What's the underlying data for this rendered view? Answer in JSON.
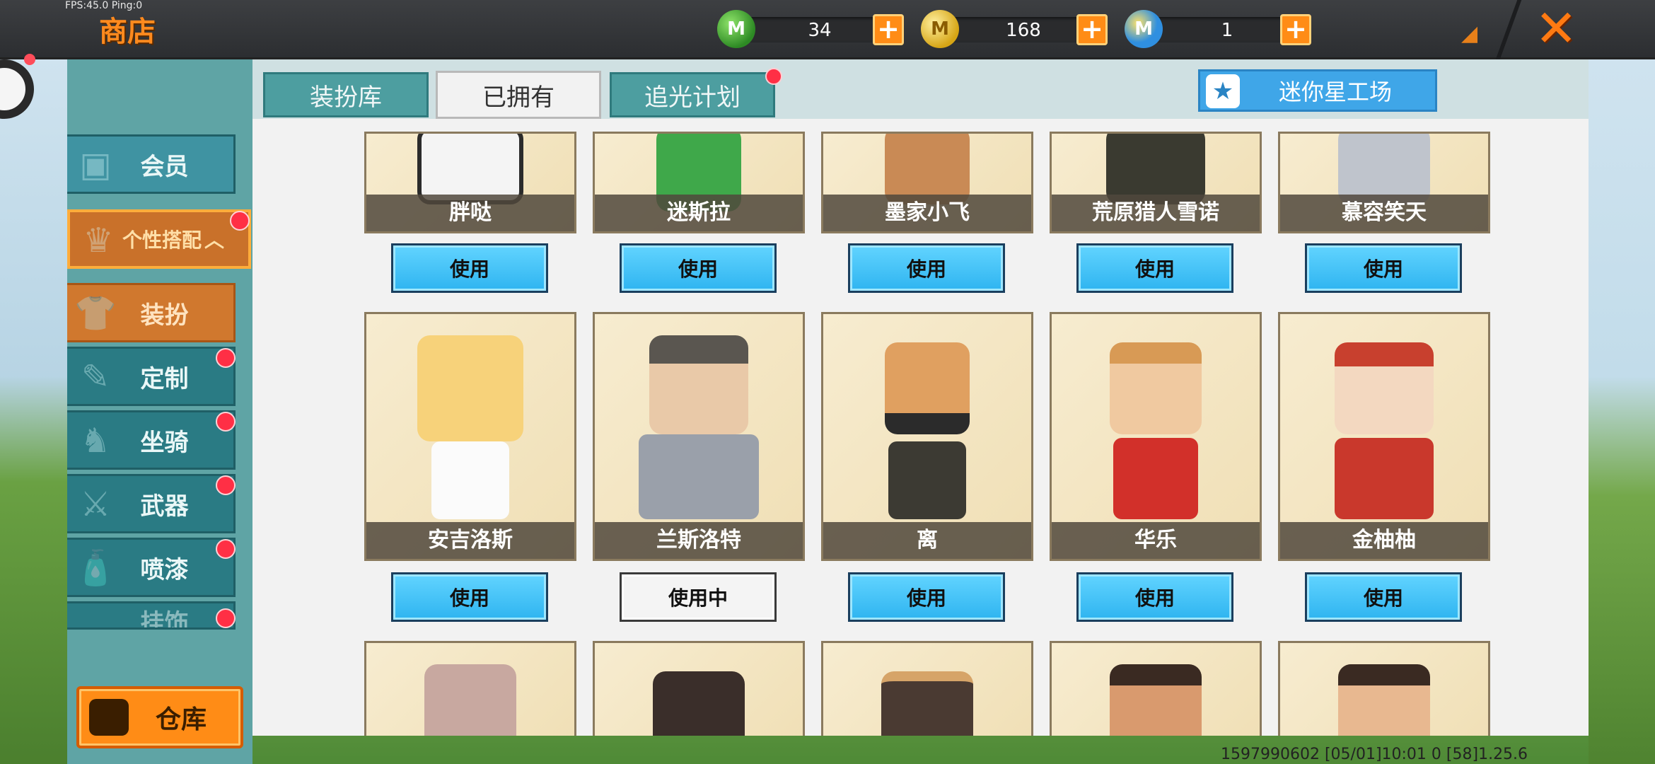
{
  "status_overlay": "FPS:45.0  Ping:0",
  "header": {
    "title": "商店",
    "currencies": [
      {
        "icon": "green-m-coin-icon",
        "value": "34"
      },
      {
        "icon": "gold-m-coin-icon",
        "value": "168"
      },
      {
        "icon": "blue-m-coin-icon",
        "value": "1"
      }
    ],
    "plus_label": "+",
    "close_label": "✕"
  },
  "sidebar": {
    "vip": "会员",
    "group": "个性搭配",
    "items": [
      {
        "label": "装扮",
        "active": true
      },
      {
        "label": "定制",
        "badge": true
      },
      {
        "label": "坐骑",
        "badge": true
      },
      {
        "label": "武器",
        "badge": true
      },
      {
        "label": "喷漆",
        "badge": true
      },
      {
        "label": "挂饰",
        "badge": true
      }
    ],
    "storage": "仓库"
  },
  "tabs": [
    {
      "label": "装扮库"
    },
    {
      "label": "已拥有",
      "active": true
    },
    {
      "label": "追光计划",
      "badge": true
    }
  ],
  "workshop": "迷你星工场",
  "cards_row1": [
    {
      "name": "胖哒",
      "button": "使用"
    },
    {
      "name": "迷斯拉",
      "button": "使用"
    },
    {
      "name": "墨家小飞",
      "button": "使用"
    },
    {
      "name": "荒原猎人雪诺",
      "button": "使用"
    },
    {
      "name": "慕容笑天",
      "button": "使用"
    }
  ],
  "cards_row2": [
    {
      "name": "安吉洛斯",
      "button": "使用"
    },
    {
      "name": "兰斯洛特",
      "button": "使用中"
    },
    {
      "name": "离",
      "button": "使用"
    },
    {
      "name": "华乐",
      "button": "使用"
    },
    {
      "name": "金柚柚",
      "button": "使用"
    }
  ],
  "footer_status": "1597990602  [05/01]10:01 0    [58]1.25.6",
  "colors": {
    "accent_orange": "#ff8c16",
    "use_button_blue": "#2eb4f0",
    "sidebar_teal": "#2a7b84",
    "badge_red": "#ff2f45"
  }
}
